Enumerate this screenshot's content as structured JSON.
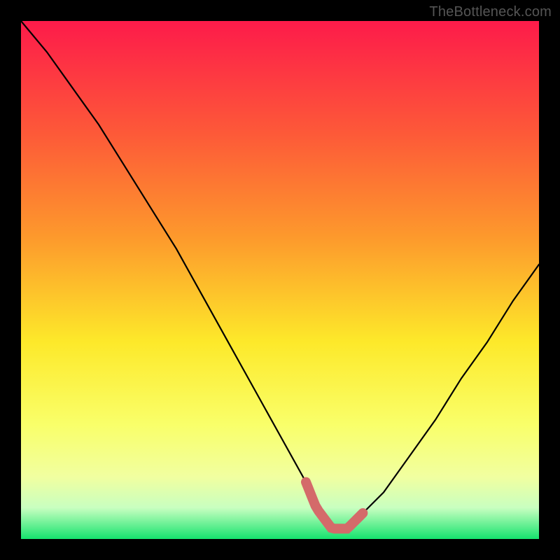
{
  "watermark": "TheBottleneck.com",
  "colors": {
    "background": "#000000",
    "gradient_top": "#fd1b4a",
    "gradient_mid1": "#fd8a2c",
    "gradient_mid2": "#fde92a",
    "gradient_mid3": "#f9ff6a",
    "gradient_mid4": "#e6ffb8",
    "gradient_bottom": "#15e36e",
    "curve_stroke": "#000000",
    "marker_stroke": "#d46a6a"
  },
  "chart_data": {
    "type": "line",
    "title": "",
    "xlabel": "",
    "ylabel": "",
    "xlim": [
      0,
      100
    ],
    "ylim": [
      0,
      100
    ],
    "series": [
      {
        "name": "bottleneck-curve",
        "x": [
          0,
          5,
          10,
          15,
          20,
          25,
          30,
          35,
          40,
          45,
          50,
          55,
          57,
          60,
          63,
          65,
          70,
          75,
          80,
          85,
          90,
          95,
          100
        ],
        "y": [
          100,
          94,
          87,
          80,
          72,
          64,
          56,
          47,
          38,
          29,
          20,
          11,
          6,
          2,
          2,
          4,
          9,
          16,
          23,
          31,
          38,
          46,
          53
        ]
      }
    ],
    "annotations": [
      {
        "name": "optimal-zone-marker",
        "x_range": [
          55,
          66
        ],
        "y": 2
      }
    ]
  }
}
